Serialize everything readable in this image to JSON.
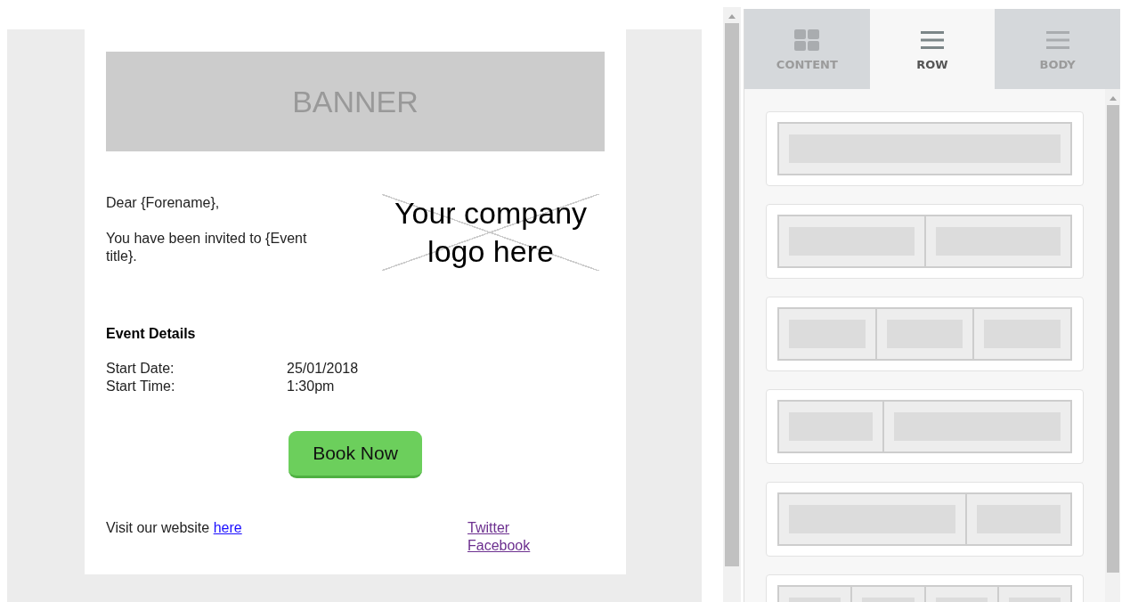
{
  "email": {
    "banner": "BANNER",
    "greeting": "Dear {Forename},",
    "invite": "You have been invited to {Event title}.",
    "logo_placeholder": "Your company logo here",
    "details_heading": "Event Details",
    "details": [
      {
        "label": "Start Date:",
        "value": "25/01/2018"
      },
      {
        "label": "Start Time:",
        "value": "1:30pm"
      }
    ],
    "button": "Book Now",
    "footer_text": "Visit our website",
    "footer_link": "here",
    "social_links": [
      {
        "label": "Twitter",
        "visited": true
      },
      {
        "label": "Facebook",
        "visited": true
      }
    ]
  },
  "tabs": [
    {
      "label": "CONTENT",
      "kind": "grid",
      "selected": false
    },
    {
      "label": "ROW",
      "kind": "lines",
      "selected": true
    },
    {
      "label": "BODY",
      "kind": "lines",
      "selected": false
    }
  ],
  "row_layouts": [
    {
      "kind": "one"
    },
    {
      "kind": "two"
    },
    {
      "kind": "three"
    },
    {
      "kind": "one-two"
    },
    {
      "kind": "two-one"
    },
    {
      "kind": "four"
    }
  ]
}
